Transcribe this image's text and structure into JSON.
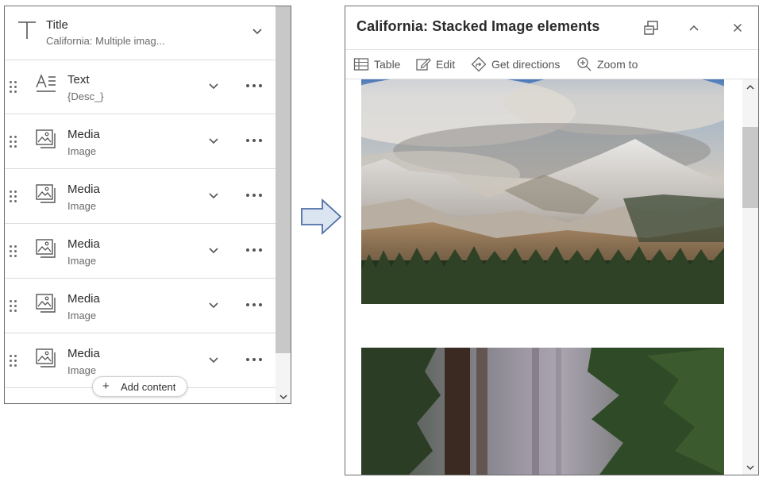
{
  "left_panel": {
    "title_element": {
      "name": "Title",
      "subtitle": "California: Multiple imag..."
    },
    "elements": [
      {
        "name": "Text",
        "subtitle": "{Desc_}",
        "icon": "text-icon"
      },
      {
        "name": "Media",
        "subtitle": "Image",
        "icon": "image-icon"
      },
      {
        "name": "Media",
        "subtitle": "Image",
        "icon": "image-icon"
      },
      {
        "name": "Media",
        "subtitle": "Image",
        "icon": "image-icon"
      },
      {
        "name": "Media",
        "subtitle": "Image",
        "icon": "image-icon"
      },
      {
        "name": "Media",
        "subtitle": "Image",
        "icon": "image-icon"
      }
    ],
    "add_content_label": "Add content"
  },
  "popup": {
    "title": "California: Stacked Image elements",
    "toolbar": {
      "table_label": "Table",
      "edit_label": "Edit",
      "directions_label": "Get directions",
      "zoom_label": "Zoom to"
    }
  },
  "colors": {
    "arrow_fill": "#dbe5f1",
    "arrow_stroke": "#4f6fa8",
    "border": "#6e6e6e"
  }
}
